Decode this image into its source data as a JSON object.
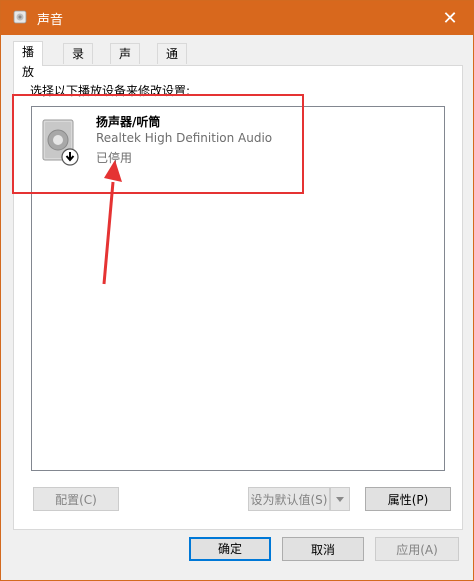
{
  "window": {
    "title": "声音",
    "close_glyph": "✕",
    "accent_color": "#d8681d"
  },
  "tabs": [
    {
      "label": "播放",
      "active": true
    },
    {
      "label": "录制",
      "active": false
    },
    {
      "label": "声音",
      "active": false
    },
    {
      "label": "通信",
      "active": false
    }
  ],
  "panel": {
    "instruction": "选择以下播放设备来修改设置:"
  },
  "device": {
    "name": "扬声器/听筒",
    "description": "Realtek High Definition Audio",
    "status": "已停用",
    "icon": "speaker-icon",
    "status_icon": "down-arrow-badge-icon"
  },
  "buttons": {
    "configure": "配置(C)",
    "set_default": "设为默认值(S)",
    "properties": "属性(P)",
    "ok": "确定",
    "cancel": "取消",
    "apply": "应用(A)"
  },
  "annotation": {
    "color": "#e53333"
  }
}
